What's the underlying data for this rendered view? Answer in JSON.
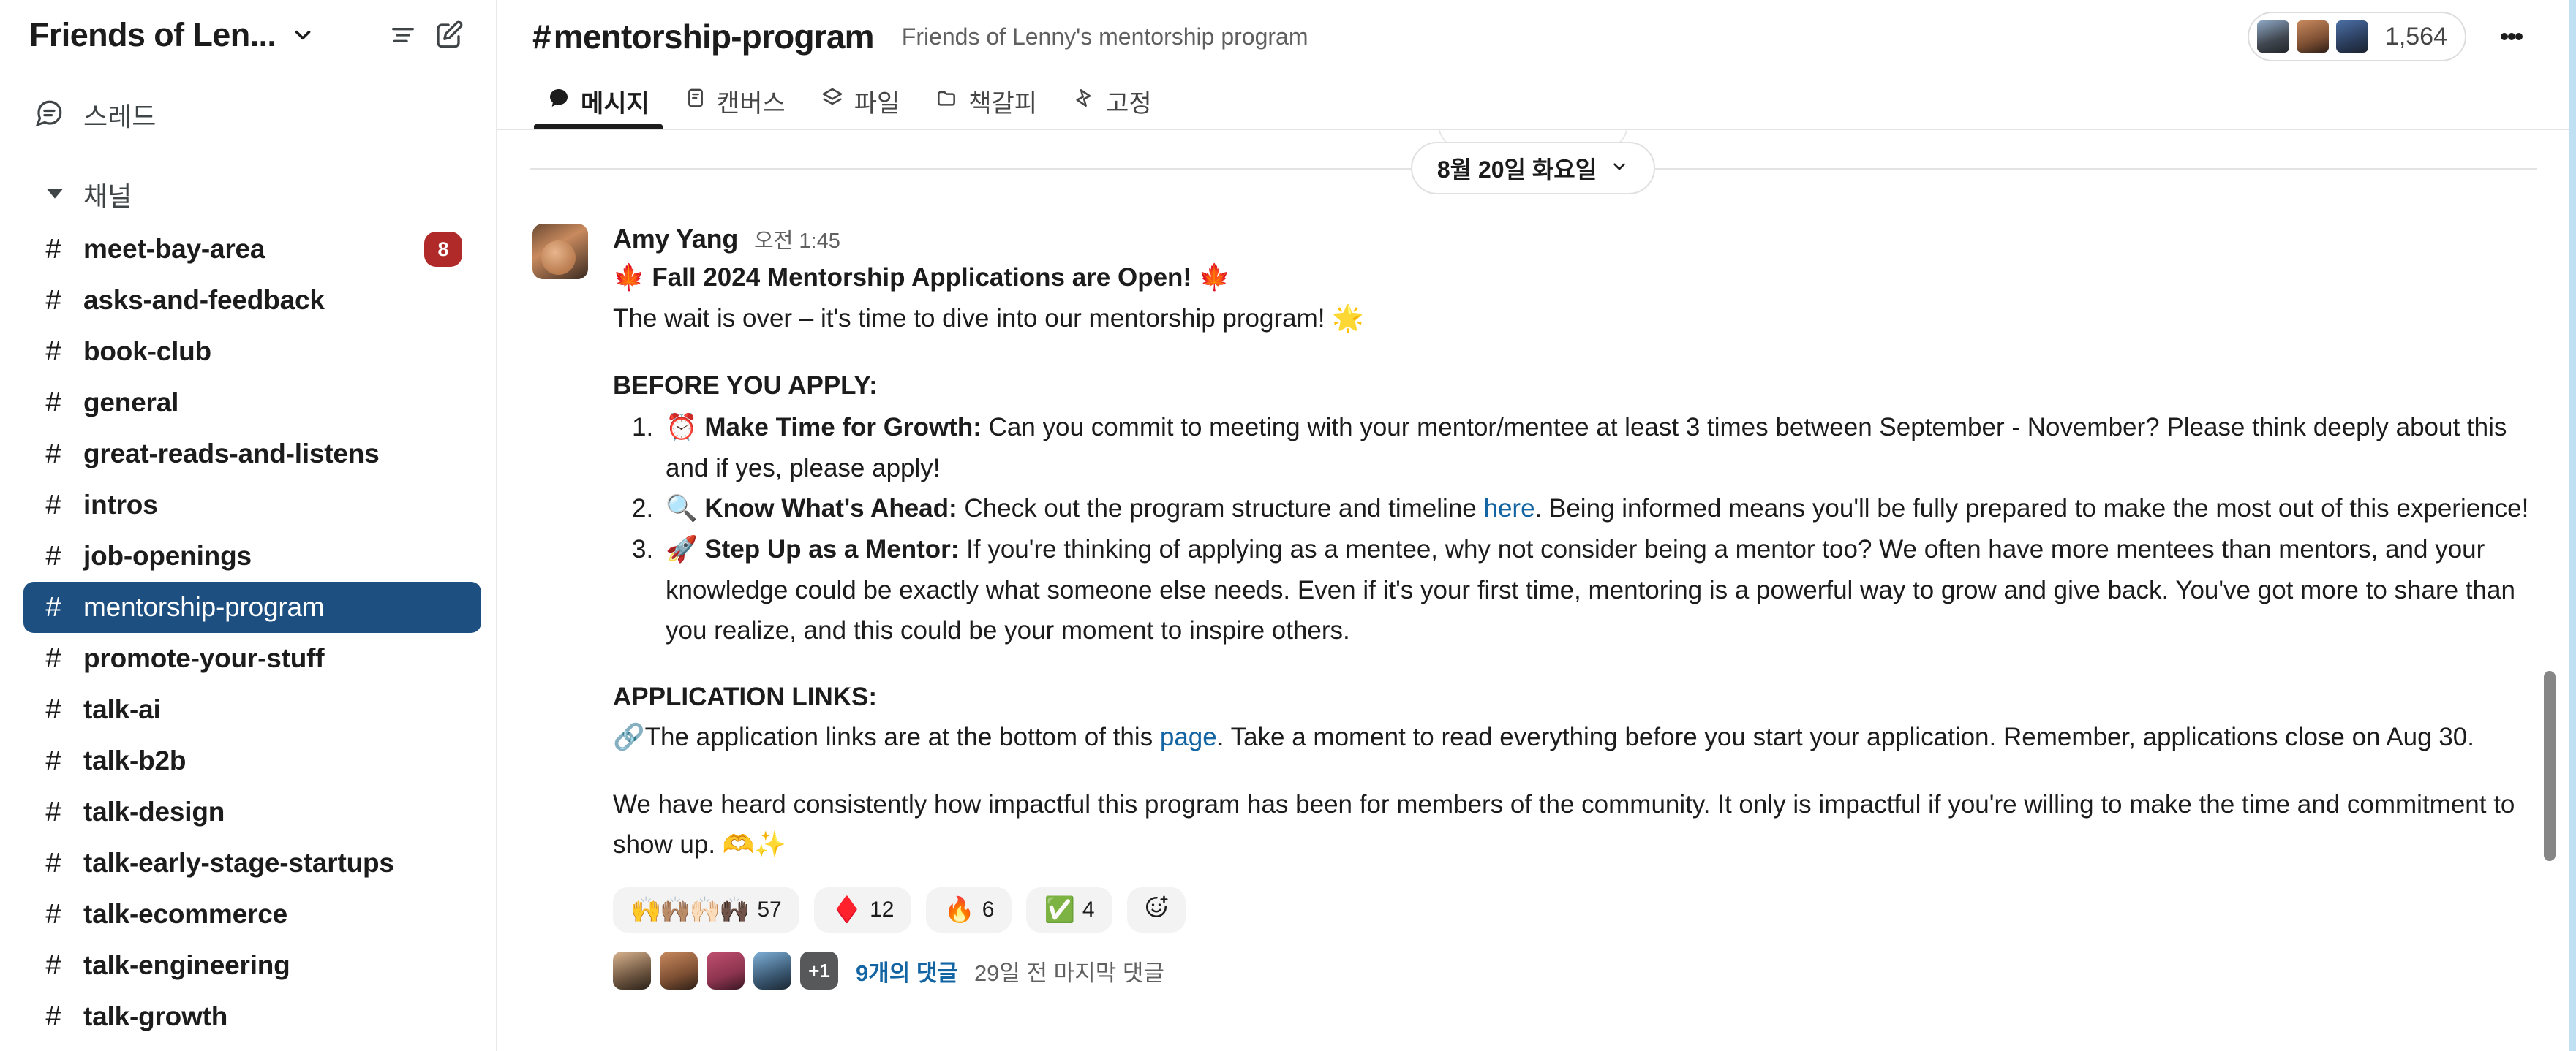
{
  "sidebar": {
    "workspace_name": "Friends of Len...",
    "icons": {
      "caret": "chevron-down-icon",
      "filter": "filter-icon",
      "compose": "compose-icon"
    },
    "threads_label": "스레드",
    "section_label": "채널",
    "channels": [
      {
        "name": "meet-bay-area",
        "badge": "8",
        "selected": false
      },
      {
        "name": "asks-and-feedback",
        "badge": "",
        "selected": false
      },
      {
        "name": "book-club",
        "badge": "",
        "selected": false
      },
      {
        "name": "general",
        "badge": "",
        "selected": false
      },
      {
        "name": "great-reads-and-listens",
        "badge": "",
        "selected": false
      },
      {
        "name": "intros",
        "badge": "",
        "selected": false
      },
      {
        "name": "job-openings",
        "badge": "",
        "selected": false
      },
      {
        "name": "mentorship-program",
        "badge": "",
        "selected": true
      },
      {
        "name": "promote-your-stuff",
        "badge": "",
        "selected": false
      },
      {
        "name": "talk-ai",
        "badge": "",
        "selected": false
      },
      {
        "name": "talk-b2b",
        "badge": "",
        "selected": false
      },
      {
        "name": "talk-design",
        "badge": "",
        "selected": false
      },
      {
        "name": "talk-early-stage-startups",
        "badge": "",
        "selected": false
      },
      {
        "name": "talk-ecommerce",
        "badge": "",
        "selected": false
      },
      {
        "name": "talk-engineering",
        "badge": "",
        "selected": false
      },
      {
        "name": "talk-growth",
        "badge": "",
        "selected": false
      }
    ],
    "hash_symbol": "#"
  },
  "header": {
    "hash": "#",
    "channel": "mentorship-program",
    "topic": "Friends of Lenny's mentorship program",
    "member_count": "1,564"
  },
  "tabs": [
    {
      "label": "메시지",
      "icon": "messages-icon",
      "active": true
    },
    {
      "label": "캔버스",
      "icon": "canvas-icon",
      "active": false
    },
    {
      "label": "파일",
      "icon": "files-icon",
      "active": false
    },
    {
      "label": "책갈피",
      "icon": "bookmarks-icon",
      "active": false
    },
    {
      "label": "고정",
      "icon": "pinned-icon",
      "active": false
    }
  ],
  "divider": {
    "date": "8월 20일 화요일"
  },
  "message": {
    "author": "Amy Yang",
    "time": "오전 1:45",
    "title_emoji_left": "🍁",
    "title": "Fall 2024 Mentorship Applications are Open!",
    "title_emoji_right": "🍁",
    "intro": "The wait is over – it's time to dive into our mentorship program!",
    "intro_emoji": "🌟",
    "before_heading": "BEFORE YOU APPLY:",
    "steps": [
      {
        "emoji": "⏰",
        "strong": "Make Time for Growth:",
        "text": " Can you commit to meeting with your mentor/mentee at least 3 times between September - November? Please think deeply about this and if yes, please apply!"
      },
      {
        "emoji": "🔍",
        "strong": "Know What's Ahead:",
        "text_before": " Check out the program structure and timeline ",
        "link": "here",
        "text_after": ". Being informed means you'll be fully prepared to make the most out of this experience!"
      },
      {
        "emoji": "🚀",
        "strong": "Step Up as a Mentor:",
        "text": " If you're thinking of applying as a mentee, why not consider being a mentor too? We often have more mentees than mentors, and your knowledge could be exactly what someone else needs. Even if it's your first time, mentoring is a powerful way to grow and give back. You've got more to share than you realize, and this could be your moment to inspire others."
      }
    ],
    "links_heading": "APPLICATION LINKS:",
    "links_emoji": "🔗",
    "links_text_before": "The application links are at the bottom of this ",
    "links_link": "page",
    "links_text_after": ". Take a moment to read everything before you start your application. Remember, applications close on Aug 30.",
    "closing": "We have heard consistently how impactful this program has been for members of the community. It only is impactful if you're willing to make the time and commitment to show up.",
    "closing_emoji": "🫶✨",
    "reactions": [
      {
        "emoji": "🙌🙌🏽🙌🏻🙌🏿",
        "count": "57"
      },
      {
        "emoji": "♦️",
        "count": "12"
      },
      {
        "emoji": "🔥",
        "count": "6"
      },
      {
        "emoji": "✅",
        "count": "4"
      }
    ],
    "add_reaction_icon": "add-reaction-icon",
    "thread": {
      "plus_label": "+1",
      "reply_count": "9개의 댓글",
      "last_reply": "29일 전 마지막 댓글"
    }
  },
  "colors": {
    "selected_channel_bg": "#1d5081",
    "badge_bg": "#b02a2a",
    "link": "#1264a3",
    "right_border": "#bfe0f2"
  }
}
